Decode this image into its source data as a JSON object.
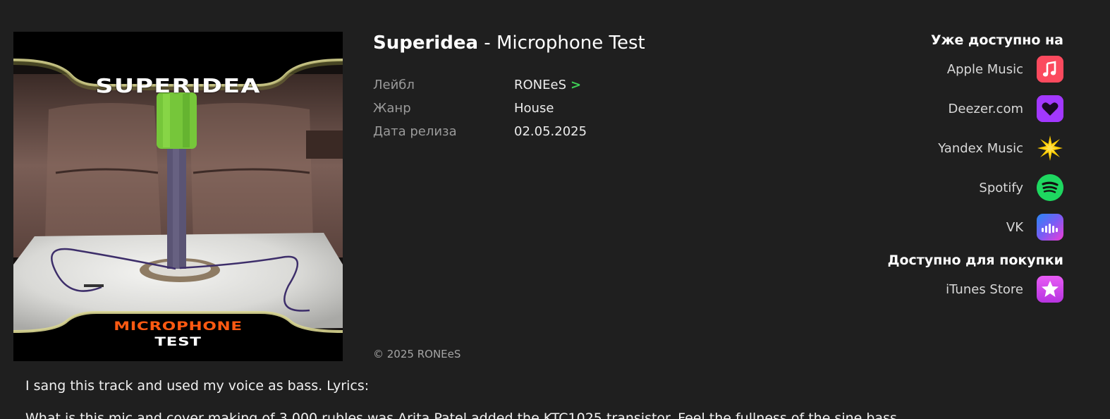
{
  "cover": {
    "title_text": "SUPERIDEA",
    "subtitle_line1": "MICROPHONE",
    "subtitle_line2": "TEST"
  },
  "release": {
    "artist": "Superidea",
    "separator": " - ",
    "track": "Microphone Test"
  },
  "meta": {
    "label_key": "Лейбл",
    "label_value": "RONEeS",
    "label_arrow": ">",
    "genre_key": "Жанр",
    "genre_value": "House",
    "date_key": "Дата релиза",
    "date_value": "02.05.2025"
  },
  "copyright": "©  2025 RONEeS",
  "platforms": {
    "available_heading": "Уже доступно на",
    "streaming": [
      {
        "name": "Apple Music",
        "icon": "apple-music-icon",
        "color": "#fa3c55"
      },
      {
        "name": "Deezer.com",
        "icon": "deezer-icon",
        "color": "#a238ff"
      },
      {
        "name": "Yandex Music",
        "icon": "yandex-music-icon",
        "color": "#ffcc00"
      },
      {
        "name": "Spotify",
        "icon": "spotify-icon",
        "color": "#1ed760"
      },
      {
        "name": "VK",
        "icon": "vk-music-icon",
        "color": "#2787f5"
      }
    ],
    "purchase_heading": "Доступно для покупки",
    "purchase": [
      {
        "name": "iTunes Store",
        "icon": "itunes-store-icon",
        "color": "#d94cf0"
      }
    ]
  },
  "description": {
    "line1": "I sang this track and used my voice as bass. Lyrics:",
    "line2": "What is this mic and cover making of 3,000 rubles was Arita Patel added the KTC1025 transistor. Feel the fullness of the sine bass"
  },
  "colors": {
    "background": "#1f1f1f",
    "accent_green": "#3ecf55"
  }
}
